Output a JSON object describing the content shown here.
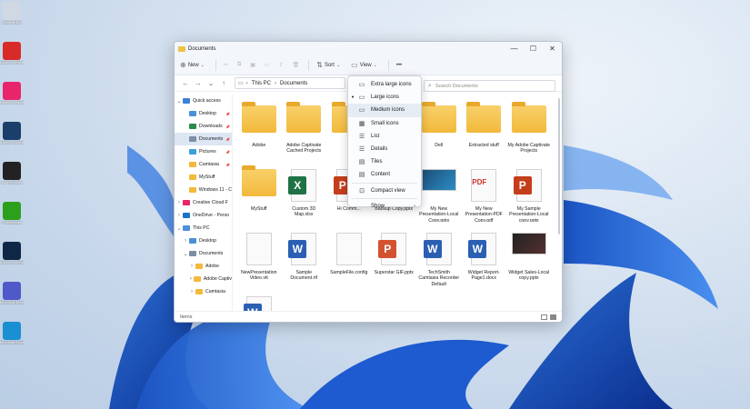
{
  "desktop": {
    "icons": [
      {
        "label": "Recycle Bin",
        "icon": "recycle-bin-icon",
        "color": "#cfd8e3"
      },
      {
        "label": "Adobe Acrobat DC",
        "icon": "acrobat-icon",
        "color": "#d82b27"
      },
      {
        "label": "Adobe Creative Cloud",
        "icon": "creative-cloud-icon",
        "color": "#e8246b"
      },
      {
        "label": "Adobe Captivate",
        "icon": "captivate-icon",
        "color": "#1a3f6a"
      },
      {
        "label": "Logi Options",
        "icon": "logi-icon",
        "color": "#222222"
      },
      {
        "label": "QuickBooks",
        "icon": "quickbooks-icon",
        "color": "#2ca01c"
      },
      {
        "label": "Adobe Lightroom",
        "icon": "lightroom-icon",
        "color": "#0f2747"
      },
      {
        "label": "Microsoft Teams",
        "icon": "teams-icon",
        "color": "#5059c9"
      },
      {
        "label": "Microsoft Edge",
        "icon": "edge-icon",
        "color": "#1a8fd1"
      }
    ]
  },
  "window": {
    "title": "Documents",
    "controls": {
      "minimize": "—",
      "maximize": "☐",
      "close": "✕"
    }
  },
  "toolbar": {
    "new_label": "New",
    "sort_label": "Sort",
    "view_label": "View",
    "more_label": "•••"
  },
  "address": {
    "crumbs": [
      "This PC",
      "Documents"
    ],
    "search_placeholder": "Search Documents"
  },
  "sidebar": {
    "items": [
      {
        "label": "Quick access",
        "chev": "⌄",
        "color": "#3b82d6",
        "indent": 0,
        "pin": false
      },
      {
        "label": "Desktop",
        "chev": "",
        "color": "#4a90d9",
        "indent": 1,
        "pin": true
      },
      {
        "label": "Downloads",
        "chev": "",
        "color": "#2a8c4a",
        "indent": 1,
        "pin": true
      },
      {
        "label": "Documents",
        "chev": "",
        "color": "#7c8fa6",
        "indent": 1,
        "pin": true,
        "selected": true
      },
      {
        "label": "Pictures",
        "chev": "",
        "color": "#3aa0d8",
        "indent": 1,
        "pin": true
      },
      {
        "label": "Camtasia",
        "chev": "",
        "color": "#f2b93b",
        "indent": 1,
        "pin": true
      },
      {
        "label": "MyStuff",
        "chev": "",
        "color": "#f2b93b",
        "indent": 1,
        "pin": false
      },
      {
        "label": "Windows 11 - C",
        "chev": "",
        "color": "#f2b93b",
        "indent": 1,
        "pin": false
      },
      {
        "label": "Creative Cloud F",
        "chev": "›",
        "color": "#e8246b",
        "indent": 0,
        "pin": false
      },
      {
        "label": "OneDrive - Perso",
        "chev": "›",
        "color": "#1a73c9",
        "indent": 0,
        "pin": false
      },
      {
        "label": "This PC",
        "chev": "⌄",
        "color": "#4a90d9",
        "indent": 0,
        "pin": false
      },
      {
        "label": "Desktop",
        "chev": "›",
        "color": "#4a90d9",
        "indent": 1,
        "pin": false
      },
      {
        "label": "Documents",
        "chev": "⌄",
        "color": "#7c8fa6",
        "indent": 1,
        "pin": false
      },
      {
        "label": "Adobe",
        "chev": "›",
        "color": "#f2b93b",
        "indent": 2,
        "pin": false
      },
      {
        "label": "Adobe Captiv",
        "chev": "›",
        "color": "#f2b93b",
        "indent": 2,
        "pin": false
      },
      {
        "label": "Camtasia",
        "chev": "›",
        "color": "#f2b93b",
        "indent": 2,
        "pin": false
      }
    ]
  },
  "files": [
    {
      "name": "Adobe",
      "kind": "folder"
    },
    {
      "name": "Adobe Captivate Cached Projects",
      "kind": "folder"
    },
    {
      "name": "C",
      "kind": "folder"
    },
    {
      "name": "",
      "kind": "hidden"
    },
    {
      "name": "Dell",
      "kind": "folder"
    },
    {
      "name": "Extracted stuff",
      "kind": "folder"
    },
    {
      "name": "My Adobe Captivate Projects",
      "kind": "folder"
    },
    {
      "name": "MyStuff",
      "kind": "folder"
    },
    {
      "name": "Custom 3D Map.xlsx",
      "kind": "excel"
    },
    {
      "name": "Hi Comm...",
      "kind": "ppt"
    },
    {
      "name": "Backup Copy.pptx",
      "kind": "hidden-label"
    },
    {
      "name": "My New Presentation-Local Copy.pptx",
      "kind": "slide"
    },
    {
      "name": "My New Presentation-PDF Copy.pdf",
      "kind": "pdf"
    },
    {
      "name": "My Sample Presentation-Local copy.pptx",
      "kind": "ppt"
    },
    {
      "name": "NewPresentation Video.vtt",
      "kind": "blank"
    },
    {
      "name": "Sample Document.rtf",
      "kind": "word"
    },
    {
      "name": "SampleFile.config",
      "kind": "blank"
    },
    {
      "name": "Superstar GIF.pptx",
      "kind": "gif"
    },
    {
      "name": "TechSmith Camtasia Recorder Default Directory.docx",
      "kind": "word"
    },
    {
      "name": "Widget Report-Page1.docx",
      "kind": "word"
    },
    {
      "name": "Widget Sales-Local copy.pptx",
      "kind": "slidedark"
    },
    {
      "name": "",
      "kind": "word"
    }
  ],
  "view_menu": {
    "items": [
      {
        "label": "Extra large icons",
        "icon": "extra-large-icons-icon",
        "glyph": "▭",
        "checked": false
      },
      {
        "label": "Large icons",
        "icon": "large-icons-icon",
        "glyph": "▭",
        "checked": true
      },
      {
        "label": "Medium icons",
        "icon": "medium-icons-icon",
        "glyph": "▭",
        "checked": false,
        "hover": true
      },
      {
        "label": "Small icons",
        "icon": "small-icons-icon",
        "glyph": "▦",
        "checked": false
      },
      {
        "label": "List",
        "icon": "list-icon",
        "glyph": "☰",
        "checked": false
      },
      {
        "label": "Details",
        "icon": "details-icon",
        "glyph": "☰",
        "checked": false
      },
      {
        "label": "Tiles",
        "icon": "tiles-icon",
        "glyph": "▤",
        "checked": false
      },
      {
        "label": "Content",
        "icon": "content-icon",
        "glyph": "▤",
        "checked": false
      },
      {
        "label": "Compact view",
        "icon": "compact-view-icon",
        "glyph": "⊡",
        "checked": false,
        "sep_before": true
      },
      {
        "label": "Show",
        "icon": "show-icon",
        "glyph": "",
        "checked": false,
        "sep_before": true,
        "submenu": true
      }
    ]
  },
  "status": {
    "items_label": "Items"
  }
}
